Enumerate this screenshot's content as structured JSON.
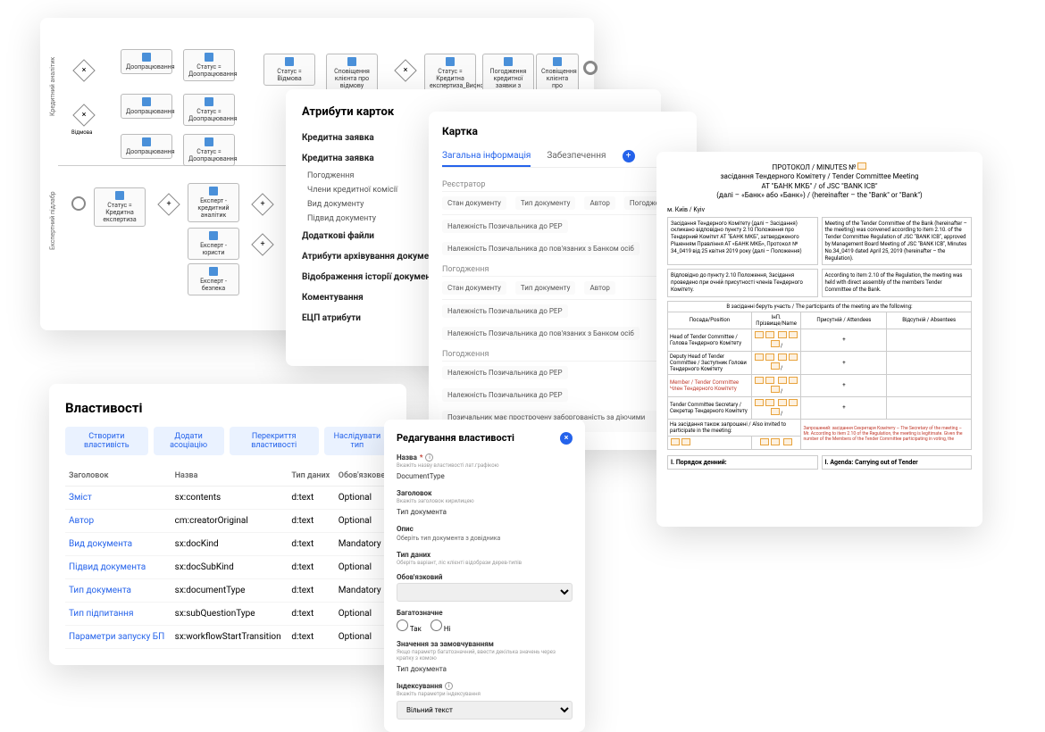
{
  "diagram": {
    "vlabels": [
      "Кредитний аналітик",
      "Експертний підлабр"
    ],
    "refusal_label": "Відмова",
    "nodes": [
      {
        "id": "d1",
        "label": "Доопрацювання"
      },
      {
        "id": "d2",
        "label": "Статус = Доопрацювання"
      },
      {
        "id": "d3",
        "label": "Доопрацювання"
      },
      {
        "id": "d4",
        "label": "Статус = Доопрацювання"
      },
      {
        "id": "d5",
        "label": "Доопрацювання"
      },
      {
        "id": "d6",
        "label": "Статус = Доопрацювання"
      },
      {
        "id": "s1",
        "label": "Статус = Відмова"
      },
      {
        "id": "s2",
        "label": "Сповіщення клієнта про відмову"
      },
      {
        "id": "s3",
        "label": "Статус = Кредитна експертиза_Висновок"
      },
      {
        "id": "s4",
        "label": "Погодження кредитної заявки з Клієнтом"
      },
      {
        "id": "s5",
        "label": "Сповіщення клієнта про ухвалення"
      },
      {
        "id": "e1",
        "label": "Статус = Кредитна експертиза"
      },
      {
        "id": "e2",
        "label": "Експерт - кредитний аналітик"
      },
      {
        "id": "e3",
        "label": "Експерт - юристи"
      },
      {
        "id": "e4",
        "label": "Експерт - безпека"
      }
    ]
  },
  "attrs": {
    "title": "Атрибути карток",
    "sections": [
      {
        "label": "Кредитна заявка",
        "items": []
      },
      {
        "label": "Кредитна заявка",
        "items": [
          "Погодження",
          "Члени кредитної комісії",
          "Вид документу",
          "Підвид документу"
        ]
      },
      {
        "label": "Додаткові файли",
        "items": []
      },
      {
        "label": "Атрибути архівування документу",
        "items": []
      },
      {
        "label": "Відображення історії документів",
        "items": []
      },
      {
        "label": "Коментування",
        "items": []
      },
      {
        "label": "ЕЦП атрибути",
        "items": []
      }
    ]
  },
  "card": {
    "title": "Картка",
    "tabs": [
      "Загальна інформація",
      "Забезпечення"
    ],
    "groups": [
      {
        "label": "Реєстратор",
        "fields": [
          "Стан документу",
          "Тип документу",
          "Автор",
          "Погодження"
        ]
      },
      {
        "label": "",
        "fields": [
          "Належність Позичальника до РЕР",
          "Належність Позичальника до пов'язаних з Банком осіб"
        ]
      },
      {
        "label": "Погодження",
        "fields": [
          "Стан документу",
          "Тип документу",
          "Автор"
        ]
      },
      {
        "label": "",
        "fields": [
          "Належність Позичальника до РЕР",
          "Належність Позичальника до пов'язаних з Банком осіб"
        ]
      },
      {
        "label": "Погодження",
        "fields": [
          "Належність Позичальника до РЕР",
          "Належність Позичальника до РЕР",
          "Позичальник має прострочену заборгованість за діючими кредитами"
        ]
      }
    ]
  },
  "protocol": {
    "header_line1": "ПРОТОКОЛ / MINUTES №",
    "header_line2": "засідання Тендерного Комітету / Tender Committee Meeting",
    "header_line3": "АТ \"БАНК МКБ\" / of JSC \"BANK ICB\"",
    "header_line4": "(далі – «Банк» або «Банк») / (hereinafter – the \"Bank\" or \"Bank\")",
    "city": "м. Київ / Kyiv",
    "col_left_1": "Засідання Тендерного Комітету (далі – Засідання) скликано відповідно пункту 2.10 Положення про Тендерний Комітет АТ \"БАНК МКБ\", затвердженого Рішенням Правління АТ «БАНК МКБ», Протокол № 34_0419 від 25 квітня 2019 року (далі – Положення)",
    "col_right_1": "Meeting of the Tender Committee of the Bank (hereinafter – the meeting) was convened according to item 2.10. of the Tender Committee Regulation of JSC \"BANK ICB\", approved by Management Board Meeting of JSC \"BANK ICB\", Minutes No.34_0419 dated April 25, 2019 (hereinafter – the Regulation).",
    "col_left_2": "Відповідно до пункту 2.10 Положення, Засідання проведено при очній присутності членів Тендерного Комітету.",
    "col_right_2": "According to item 2.10 of the Regulation, the meeting was held with direct assembly of the members Tender Committee of the Bank.",
    "participants_header": "В засіданні беруть участь / The participants of the meeting are the following:",
    "th_position": "Посада/Position",
    "th_name": "ІнП. Прізвище/Name",
    "th_attend": "Присутній / Attendees",
    "th_absent": "Відсутній / Absentees",
    "rows": [
      {
        "pos": "Head of Tender Committee / Голова Тендерного Комітету",
        "attend": "+"
      },
      {
        "pos": "Deputy Head of Tender Committee / Заступник Голови Тендерного Комітету",
        "attend": "+"
      },
      {
        "pos": "Member / Tender Committee Член Тендерного Комітету",
        "attend": "+"
      },
      {
        "pos": "Tender Committee Secretary / Секретар Тендерного Комітету",
        "attend": "+"
      }
    ],
    "invited_header": "На засідання також запрошені / Also invited to participate in the meeting:",
    "secretary_note": "Запрошений: засідання Секретаря Комітету – \nThe Secretary of the meeting – Mr.\nAccording to item 2.10 of the Regulation, the meeting is legitimate.\nGiven the number of the Members of the Tender Committee participating in voting, the",
    "agenda_left": "І. Порядок денний:",
    "agenda_right": "I. Agenda: Carrying out of Tender"
  },
  "props": {
    "title": "Властивості",
    "buttons": [
      "Створити властивість",
      "Додати асоціацію",
      "Перекриття властивості",
      "Наслідувати тип"
    ],
    "headers": [
      "Заголовок",
      "Назва",
      "Тип даних",
      "Обов'язкове"
    ],
    "rows": [
      {
        "h": "Зміст",
        "n": "sx:contents",
        "t": "d:text",
        "m": "Optional"
      },
      {
        "h": "Автор",
        "n": "cm:creatorOriginal",
        "t": "d:text",
        "m": "Optional"
      },
      {
        "h": "Вид документа",
        "n": "sx:docKind",
        "t": "d:text",
        "m": "Mandatory"
      },
      {
        "h": "Підвид документа",
        "n": "sx:docSubKind",
        "t": "d:text",
        "m": "Optional"
      },
      {
        "h": "Тип документа",
        "n": "sx:documentType",
        "t": "d:text",
        "m": "Mandatory"
      },
      {
        "h": "Тип підпитання",
        "n": "sx:subQuestionType",
        "t": "d:text",
        "m": "Optional"
      },
      {
        "h": "Параметри запуску БП",
        "n": "sx:workflowStartTransition",
        "t": "d:text",
        "m": "Optional"
      }
    ]
  },
  "editprop": {
    "title": "Редагування властивості",
    "name_label": "Назва",
    "name_hint": "Вкажіть назву властивості лат.графікою",
    "name_val": "DocumentType",
    "header_label": "Заголовок",
    "header_hint": "Вкажіть заголовок кирилицею",
    "header_val": "Тип документа",
    "desc_label": "Опис",
    "desc_val": "Оберіть тип документа з довідника",
    "type_label": "Тип даних",
    "type_hint": "Оберіть варіант, ліс клієнті відобрази дерев-типів",
    "mandatory_label": "Обов'язковий",
    "multi_label": "Багатозначне",
    "radio_yes": "Так",
    "radio_no": "Ні",
    "default_label": "Значення за замовчуванням",
    "default_hint": "Якщо параметр багатозначний, ввести декілька значень через крапку з комою",
    "default_val": "Тип документа",
    "index_label": "Індексування",
    "index_hint": "Вкажіть параметри індексування",
    "index_val": "Вільний текст"
  }
}
